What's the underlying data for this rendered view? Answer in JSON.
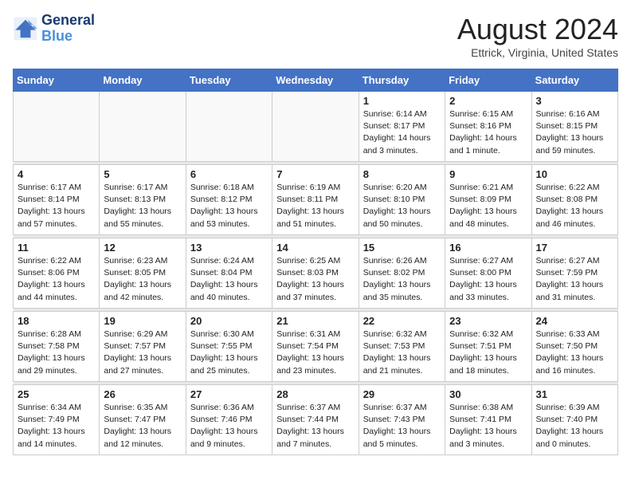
{
  "logo": {
    "line1": "General",
    "line2": "Blue"
  },
  "title": "August 2024",
  "subtitle": "Ettrick, Virginia, United States",
  "days_of_week": [
    "Sunday",
    "Monday",
    "Tuesday",
    "Wednesday",
    "Thursday",
    "Friday",
    "Saturday"
  ],
  "weeks": [
    [
      {
        "day": "",
        "sunrise": "",
        "sunset": "",
        "daylight": ""
      },
      {
        "day": "",
        "sunrise": "",
        "sunset": "",
        "daylight": ""
      },
      {
        "day": "",
        "sunrise": "",
        "sunset": "",
        "daylight": ""
      },
      {
        "day": "",
        "sunrise": "",
        "sunset": "",
        "daylight": ""
      },
      {
        "day": "1",
        "sunrise": "Sunrise: 6:14 AM",
        "sunset": "Sunset: 8:17 PM",
        "daylight": "Daylight: 14 hours and 3 minutes."
      },
      {
        "day": "2",
        "sunrise": "Sunrise: 6:15 AM",
        "sunset": "Sunset: 8:16 PM",
        "daylight": "Daylight: 14 hours and 1 minute."
      },
      {
        "day": "3",
        "sunrise": "Sunrise: 6:16 AM",
        "sunset": "Sunset: 8:15 PM",
        "daylight": "Daylight: 13 hours and 59 minutes."
      }
    ],
    [
      {
        "day": "4",
        "sunrise": "Sunrise: 6:17 AM",
        "sunset": "Sunset: 8:14 PM",
        "daylight": "Daylight: 13 hours and 57 minutes."
      },
      {
        "day": "5",
        "sunrise": "Sunrise: 6:17 AM",
        "sunset": "Sunset: 8:13 PM",
        "daylight": "Daylight: 13 hours and 55 minutes."
      },
      {
        "day": "6",
        "sunrise": "Sunrise: 6:18 AM",
        "sunset": "Sunset: 8:12 PM",
        "daylight": "Daylight: 13 hours and 53 minutes."
      },
      {
        "day": "7",
        "sunrise": "Sunrise: 6:19 AM",
        "sunset": "Sunset: 8:11 PM",
        "daylight": "Daylight: 13 hours and 51 minutes."
      },
      {
        "day": "8",
        "sunrise": "Sunrise: 6:20 AM",
        "sunset": "Sunset: 8:10 PM",
        "daylight": "Daylight: 13 hours and 50 minutes."
      },
      {
        "day": "9",
        "sunrise": "Sunrise: 6:21 AM",
        "sunset": "Sunset: 8:09 PM",
        "daylight": "Daylight: 13 hours and 48 minutes."
      },
      {
        "day": "10",
        "sunrise": "Sunrise: 6:22 AM",
        "sunset": "Sunset: 8:08 PM",
        "daylight": "Daylight: 13 hours and 46 minutes."
      }
    ],
    [
      {
        "day": "11",
        "sunrise": "Sunrise: 6:22 AM",
        "sunset": "Sunset: 8:06 PM",
        "daylight": "Daylight: 13 hours and 44 minutes."
      },
      {
        "day": "12",
        "sunrise": "Sunrise: 6:23 AM",
        "sunset": "Sunset: 8:05 PM",
        "daylight": "Daylight: 13 hours and 42 minutes."
      },
      {
        "day": "13",
        "sunrise": "Sunrise: 6:24 AM",
        "sunset": "Sunset: 8:04 PM",
        "daylight": "Daylight: 13 hours and 40 minutes."
      },
      {
        "day": "14",
        "sunrise": "Sunrise: 6:25 AM",
        "sunset": "Sunset: 8:03 PM",
        "daylight": "Daylight: 13 hours and 37 minutes."
      },
      {
        "day": "15",
        "sunrise": "Sunrise: 6:26 AM",
        "sunset": "Sunset: 8:02 PM",
        "daylight": "Daylight: 13 hours and 35 minutes."
      },
      {
        "day": "16",
        "sunrise": "Sunrise: 6:27 AM",
        "sunset": "Sunset: 8:00 PM",
        "daylight": "Daylight: 13 hours and 33 minutes."
      },
      {
        "day": "17",
        "sunrise": "Sunrise: 6:27 AM",
        "sunset": "Sunset: 7:59 PM",
        "daylight": "Daylight: 13 hours and 31 minutes."
      }
    ],
    [
      {
        "day": "18",
        "sunrise": "Sunrise: 6:28 AM",
        "sunset": "Sunset: 7:58 PM",
        "daylight": "Daylight: 13 hours and 29 minutes."
      },
      {
        "day": "19",
        "sunrise": "Sunrise: 6:29 AM",
        "sunset": "Sunset: 7:57 PM",
        "daylight": "Daylight: 13 hours and 27 minutes."
      },
      {
        "day": "20",
        "sunrise": "Sunrise: 6:30 AM",
        "sunset": "Sunset: 7:55 PM",
        "daylight": "Daylight: 13 hours and 25 minutes."
      },
      {
        "day": "21",
        "sunrise": "Sunrise: 6:31 AM",
        "sunset": "Sunset: 7:54 PM",
        "daylight": "Daylight: 13 hours and 23 minutes."
      },
      {
        "day": "22",
        "sunrise": "Sunrise: 6:32 AM",
        "sunset": "Sunset: 7:53 PM",
        "daylight": "Daylight: 13 hours and 21 minutes."
      },
      {
        "day": "23",
        "sunrise": "Sunrise: 6:32 AM",
        "sunset": "Sunset: 7:51 PM",
        "daylight": "Daylight: 13 hours and 18 minutes."
      },
      {
        "day": "24",
        "sunrise": "Sunrise: 6:33 AM",
        "sunset": "Sunset: 7:50 PM",
        "daylight": "Daylight: 13 hours and 16 minutes."
      }
    ],
    [
      {
        "day": "25",
        "sunrise": "Sunrise: 6:34 AM",
        "sunset": "Sunset: 7:49 PM",
        "daylight": "Daylight: 13 hours and 14 minutes."
      },
      {
        "day": "26",
        "sunrise": "Sunrise: 6:35 AM",
        "sunset": "Sunset: 7:47 PM",
        "daylight": "Daylight: 13 hours and 12 minutes."
      },
      {
        "day": "27",
        "sunrise": "Sunrise: 6:36 AM",
        "sunset": "Sunset: 7:46 PM",
        "daylight": "Daylight: 13 hours and 9 minutes."
      },
      {
        "day": "28",
        "sunrise": "Sunrise: 6:37 AM",
        "sunset": "Sunset: 7:44 PM",
        "daylight": "Daylight: 13 hours and 7 minutes."
      },
      {
        "day": "29",
        "sunrise": "Sunrise: 6:37 AM",
        "sunset": "Sunset: 7:43 PM",
        "daylight": "Daylight: 13 hours and 5 minutes."
      },
      {
        "day": "30",
        "sunrise": "Sunrise: 6:38 AM",
        "sunset": "Sunset: 7:41 PM",
        "daylight": "Daylight: 13 hours and 3 minutes."
      },
      {
        "day": "31",
        "sunrise": "Sunrise: 6:39 AM",
        "sunset": "Sunset: 7:40 PM",
        "daylight": "Daylight: 13 hours and 0 minutes."
      }
    ]
  ]
}
